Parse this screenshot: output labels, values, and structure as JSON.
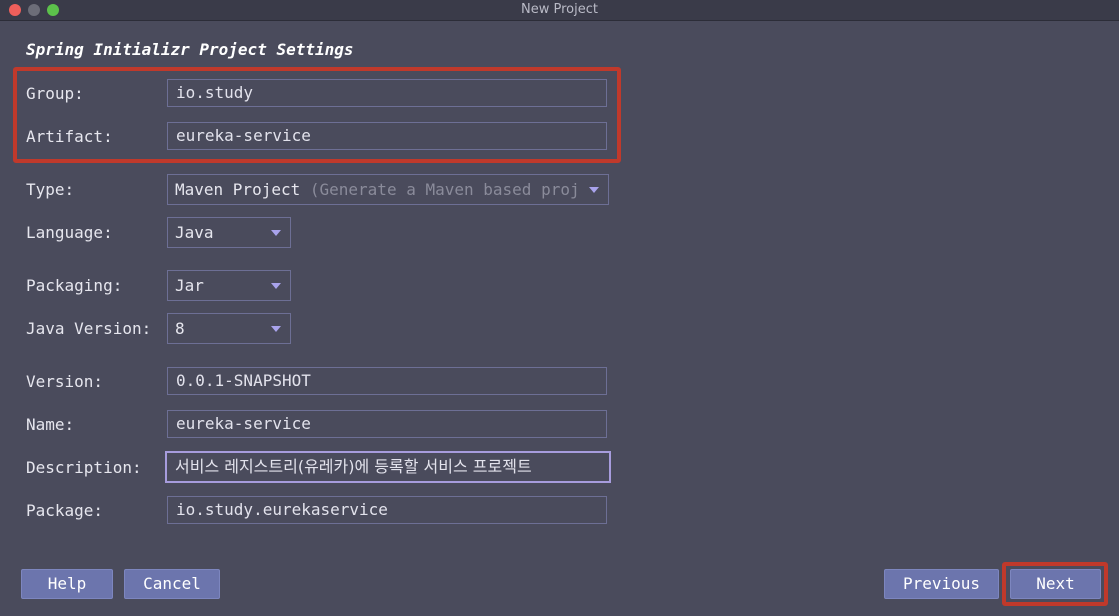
{
  "window": {
    "title": "New Project"
  },
  "form": {
    "heading": "Spring Initializr Project Settings",
    "group": {
      "label": "Group:",
      "value": "io.study"
    },
    "artifact": {
      "label": "Artifact:",
      "value": "eureka-service"
    },
    "type": {
      "label": "Type:",
      "value": "Maven Project",
      "hint": "(Generate a Maven based proj"
    },
    "language": {
      "label": "Language:",
      "value": "Java"
    },
    "packaging": {
      "label": "Packaging:",
      "value": "Jar"
    },
    "java_version": {
      "label": "Java Version:",
      "value": "8"
    },
    "version": {
      "label": "Version:",
      "value": "0.0.1-SNAPSHOT"
    },
    "name": {
      "label": "Name:",
      "value": "eureka-service"
    },
    "description": {
      "label": "Description:",
      "value": "서비스 레지스트리(유레카)에 등록할 서비스 프로젝트"
    },
    "package": {
      "label": "Package:",
      "value": "io.study.eurekaservice"
    }
  },
  "buttons": {
    "help": "Help",
    "cancel": "Cancel",
    "previous": "Previous",
    "next": "Next"
  },
  "icons": {
    "dropdown": "chevron-down-icon"
  },
  "colors": {
    "highlight": "#c0392b",
    "button": "#6c75ad",
    "focus_border": "#a79cdd"
  }
}
